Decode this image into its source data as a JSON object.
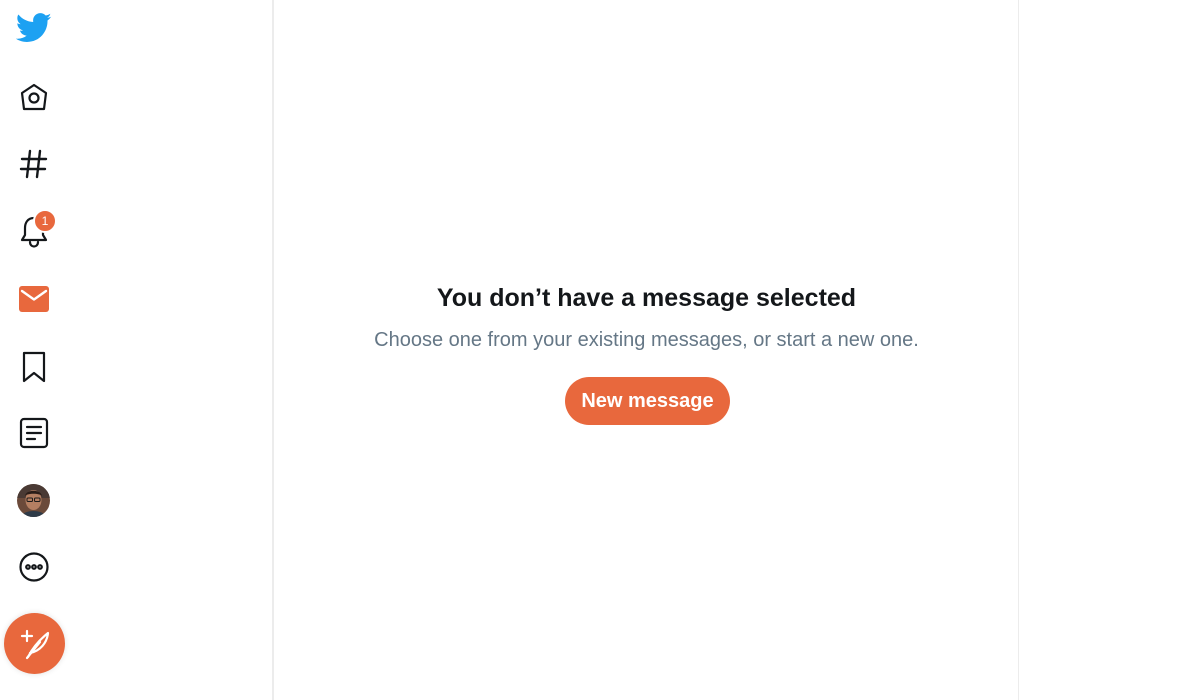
{
  "colors": {
    "accent": "#e8683d",
    "twitter_blue": "#1da1f2",
    "icon": "#14171a",
    "title": "#14171a",
    "subtitle": "#657786",
    "divider": "#ececec"
  },
  "sidebar": {
    "items": [
      {
        "name": "twitter-logo-icon",
        "icon": "twitter-bird"
      },
      {
        "name": "home-icon",
        "icon": "home"
      },
      {
        "name": "explore-icon",
        "icon": "hashtag"
      },
      {
        "name": "notifications-icon",
        "icon": "bell",
        "badge": "1"
      },
      {
        "name": "messages-icon",
        "icon": "envelope",
        "active": true
      },
      {
        "name": "bookmarks-icon",
        "icon": "bookmark"
      },
      {
        "name": "lists-icon",
        "icon": "list"
      },
      {
        "name": "profile-avatar",
        "icon": "avatar"
      },
      {
        "name": "more-icon",
        "icon": "more-circle"
      }
    ],
    "compose_icon": "feather-plus"
  },
  "main": {
    "empty_title": "You don’t have a message selected",
    "empty_subtitle": "Choose one from your existing messages, or start a new one.",
    "new_message_label": "New message"
  }
}
